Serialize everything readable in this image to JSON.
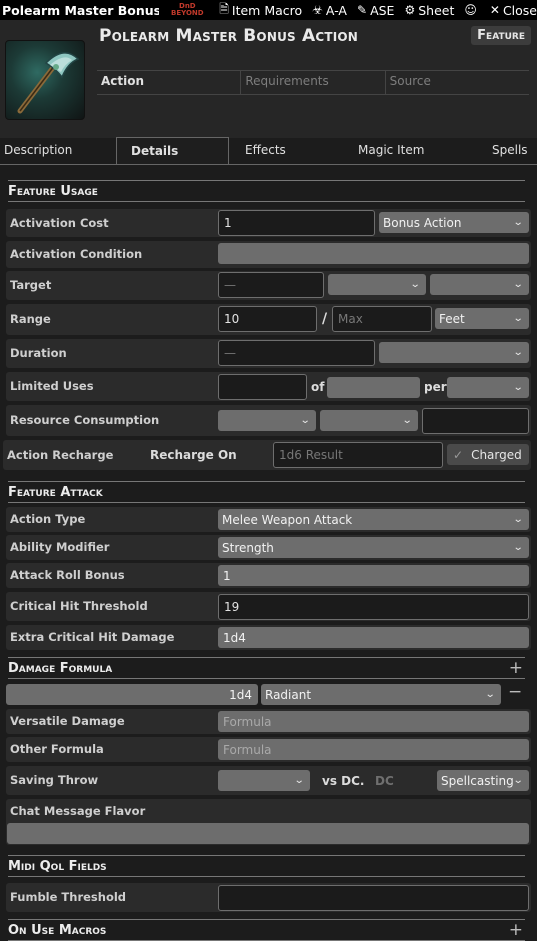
{
  "window": {
    "title": "Polearm Master Bonus Acti",
    "ddb_logo_top": "DnD",
    "ddb_logo_bottom": "BEYOND",
    "buttons": [
      {
        "icon": "file-icon",
        "glyph": "🗎",
        "label": "Item Macro"
      },
      {
        "icon": "biohazard-icon",
        "glyph": "☣",
        "label": "A-A"
      },
      {
        "icon": "pencil-icon",
        "glyph": "✎",
        "label": "ASE"
      },
      {
        "icon": "gear-icon",
        "glyph": "⚙",
        "label": "Sheet"
      },
      {
        "icon": "mask-icon",
        "glyph": "☺",
        "label": ""
      },
      {
        "icon": "close-icon",
        "glyph": "✕",
        "label": "Close"
      }
    ]
  },
  "header": {
    "name": "Polearm Master Bonus Action",
    "type": "Feature",
    "details": {
      "action": "Action",
      "requirements": "Requirements",
      "source": "Source"
    }
  },
  "tabs": [
    "Description",
    "Details",
    "Effects",
    "Magic Item",
    "Spells"
  ],
  "feature_usage": {
    "title": "Feature Usage",
    "activation_cost": {
      "label": "Activation Cost",
      "value": "1",
      "type": "Bonus Action"
    },
    "activation_condition": {
      "label": "Activation Condition"
    },
    "target": {
      "label": "Target",
      "placeholder": "—"
    },
    "range": {
      "label": "Range",
      "value": "10",
      "sep": "/",
      "max_placeholder": "Max",
      "units": "Feet"
    },
    "duration": {
      "label": "Duration",
      "placeholder": "—"
    },
    "limited_uses": {
      "label": "Limited Uses",
      "of": "of",
      "per": "per"
    },
    "resource_consumption": {
      "label": "Resource Consumption"
    },
    "action_recharge": {
      "label": "Action Recharge",
      "recharge_on": "Recharge On",
      "placeholder": "1d6 Result",
      "charged": "Charged"
    }
  },
  "feature_attack": {
    "title": "Feature Attack",
    "action_type": {
      "label": "Action Type",
      "value": "Melee Weapon Attack"
    },
    "ability_modifier": {
      "label": "Ability Modifier",
      "value": "Strength"
    },
    "attack_roll_bonus": {
      "label": "Attack Roll Bonus",
      "value": "1"
    },
    "critical_hit_threshold": {
      "label": "Critical Hit Threshold",
      "value": "19"
    },
    "extra_critical_hit_damage": {
      "label": "Extra Critical Hit Damage",
      "value": "1d4"
    }
  },
  "damage_formula": {
    "title": "Damage Formula",
    "add": "+",
    "parts": [
      {
        "formula": "1d4",
        "type": "Radiant",
        "remove": "−"
      }
    ],
    "versatile_damage": {
      "label": "Versatile Damage",
      "placeholder": "Formula"
    },
    "other_formula": {
      "label": "Other Formula",
      "placeholder": "Formula"
    },
    "saving_throw": {
      "label": "Saving Throw",
      "vs": "vs DC.",
      "dc_placeholder": "DC",
      "scaling": "Spellcasting"
    },
    "chat_flavor": {
      "label": "Chat Message Flavor"
    }
  },
  "midi": {
    "title": "Midi Qol Fields",
    "fumble_threshold": {
      "label": "Fumble Threshold"
    }
  },
  "on_use": {
    "title": "On Use Macros",
    "add": "+"
  }
}
